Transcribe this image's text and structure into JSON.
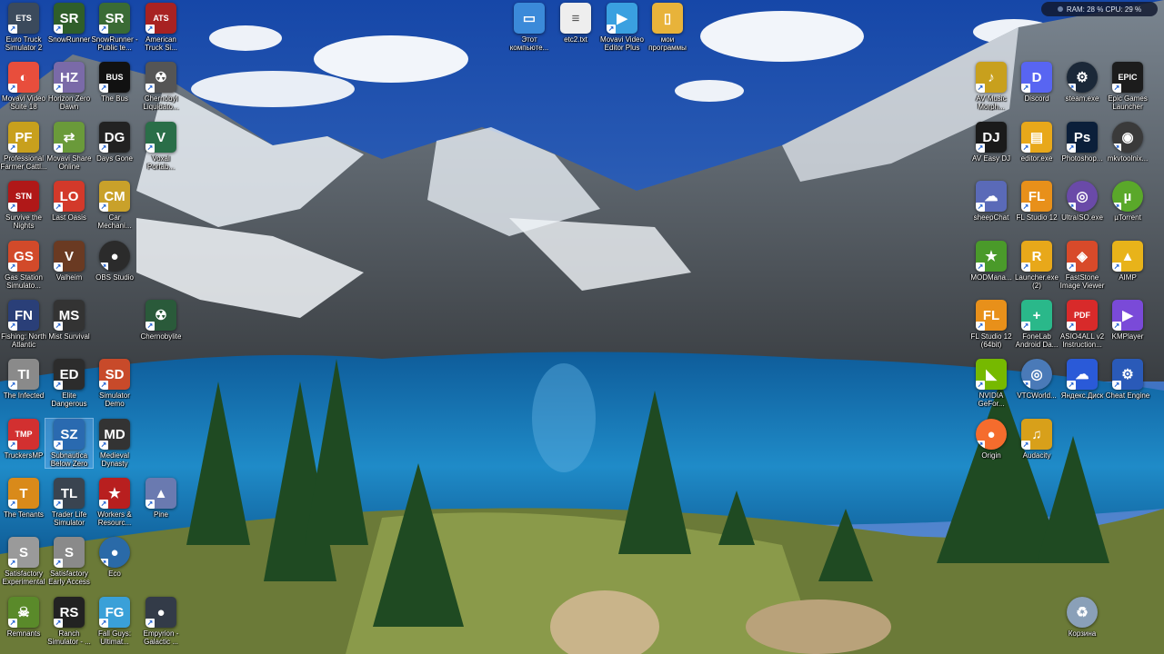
{
  "system_monitor": {
    "text": "RAM: 28 %  CPU: 29 %"
  },
  "desktop": {
    "icons": [
      {
        "label": "Euro Truck Simulator 2",
        "glyph": "ETS",
        "color": "#3b4a5c",
        "icon": "truck-icon"
      },
      {
        "label": "SnowRunner",
        "glyph": "SR",
        "color": "#2f5e2a",
        "icon": "truck-icon"
      },
      {
        "label": "SnowRunner - Public te...",
        "glyph": "SR",
        "color": "#3a6b35",
        "icon": "truck-icon"
      },
      {
        "label": "American Truck Si...",
        "glyph": "ATS",
        "color": "#a82222",
        "icon": "truck-icon"
      },
      {
        "label": "Movavi Video Suite 18",
        "glyph": "◐",
        "color": "#e84e3c",
        "icon": "movavi-icon"
      },
      {
        "label": "Horizon Zero Dawn",
        "glyph": "HZ",
        "color": "#7a6aa8",
        "icon": "game-icon"
      },
      {
        "label": "The Bus",
        "glyph": "BUS",
        "color": "#111111",
        "icon": "bus-icon"
      },
      {
        "label": "Chernobyl Liquidato...",
        "glyph": "☢",
        "color": "#555555",
        "icon": "gasmask-icon"
      },
      {
        "label": "Professional Farmer Cattl...",
        "glyph": "PF",
        "color": "#c8a01d",
        "icon": "tractor-icon"
      },
      {
        "label": "Movavi Share Online",
        "glyph": "⇄",
        "color": "#6a9a3a",
        "icon": "movavi-icon"
      },
      {
        "label": "Days Gone",
        "glyph": "DG",
        "color": "#222222",
        "icon": "game-icon"
      },
      {
        "label": "Voxal Portab...",
        "glyph": "V",
        "color": "#2a6e48",
        "icon": "voxal-icon"
      },
      {
        "label": "Survive the Nights",
        "glyph": "STN",
        "color": "#b01818",
        "icon": "game-icon"
      },
      {
        "label": "Last Oasis",
        "glyph": "LO",
        "color": "#d3392a",
        "icon": "game-icon"
      },
      {
        "label": "Car Mechani...",
        "glyph": "CM",
        "color": "#c9a12a",
        "icon": "car-icon"
      },
      {
        "label": "Gas Station Simulato...",
        "glyph": "GS",
        "color": "#d24a2a",
        "icon": "gas-icon"
      },
      {
        "label": "Valheim",
        "glyph": "V",
        "color": "#6a3a22",
        "icon": "game-icon"
      },
      {
        "label": "OBS Studio",
        "glyph": "●",
        "color": "#2b2b2b",
        "icon": "obs-icon"
      },
      {
        "label": "Fishing: North Atlantic",
        "glyph": "FN",
        "color": "#2a3f78",
        "icon": "fish-icon"
      },
      {
        "label": "Mist Survival",
        "glyph": "MS",
        "color": "#333333",
        "icon": "game-icon"
      },
      {
        "label": "Chernobylite",
        "glyph": "☢",
        "color": "#2a5a3a",
        "icon": "game-icon"
      },
      {
        "label": "The Infected",
        "glyph": "TI",
        "color": "#8a8a8a",
        "icon": "skull-icon"
      },
      {
        "label": "Elite Dangerous",
        "glyph": "ED",
        "color": "#2c2c2c",
        "icon": "game-icon"
      },
      {
        "label": "Simulator Demo",
        "glyph": "SD",
        "color": "#c84a2a",
        "icon": "game-icon"
      },
      {
        "label": "TruckersMP",
        "glyph": "TMP",
        "color": "#d23030",
        "icon": "truck-icon"
      },
      {
        "label": "Subnautica Below Zero",
        "glyph": "SZ",
        "color": "#2a6ab0",
        "icon": "game-icon"
      },
      {
        "label": "Medieval Dynasty",
        "glyph": "MD",
        "color": "#333333",
        "icon": "game-icon"
      },
      {
        "label": "The Tenants",
        "glyph": "T",
        "color": "#d98a1a",
        "icon": "game-icon"
      },
      {
        "label": "Trader Life Simulator",
        "glyph": "TL",
        "color": "#3a4450",
        "icon": "game-icon"
      },
      {
        "label": "Workers & Resourc...",
        "glyph": "★",
        "color": "#b81f1f",
        "icon": "star-icon"
      },
      {
        "label": "Pine",
        "glyph": "▲",
        "color": "#6a7ab0",
        "icon": "game-icon"
      },
      {
        "label": "Satisfactory Experimental",
        "glyph": "S",
        "color": "#9a9a9a",
        "icon": "game-icon"
      },
      {
        "label": "Satisfactory Early Access",
        "glyph": "S",
        "color": "#8a8a8a",
        "icon": "game-icon"
      },
      {
        "label": "Eco",
        "glyph": "●",
        "color": "#2a6aa8",
        "icon": "globe-icon"
      },
      {
        "label": "Remnants",
        "glyph": "☠",
        "color": "#5a8a2a",
        "icon": "game-icon"
      },
      {
        "label": "Ranch Simulator - ...",
        "glyph": "RS",
        "color": "#222222",
        "icon": "game-icon"
      },
      {
        "label": "Fall Guys: Ultimat...",
        "glyph": "FG",
        "color": "#3aa0d8",
        "icon": "game-icon"
      },
      {
        "label": "Empyrion - Galactic ...",
        "glyph": "●",
        "color": "#333b48",
        "icon": "game-icon"
      },
      {
        "label": "Этот компьюте...",
        "glyph": "▭",
        "color": "#3b8ad9",
        "icon": "computer-icon"
      },
      {
        "label": "etc2.txt",
        "glyph": "≡",
        "color": "#eeeeee",
        "icon": "text-file-icon"
      },
      {
        "label": "Movavi Video Editor Plus",
        "glyph": "▶",
        "color": "#3aa0e0",
        "icon": "movavi-icon"
      },
      {
        "label": "мои программы",
        "glyph": "▯",
        "color": "#e8b33a",
        "icon": "folder-icon"
      },
      {
        "label": "AV Music Morph...",
        "glyph": "♪",
        "color": "#c8a01d",
        "icon": "music-icon"
      },
      {
        "label": "Discord",
        "glyph": "D",
        "color": "#5865f2",
        "icon": "discord-icon"
      },
      {
        "label": "steam.exe",
        "glyph": "⚙",
        "color": "#1b2838",
        "icon": "steam-icon"
      },
      {
        "label": "Epic Games Launcher",
        "glyph": "EPIC",
        "color": "#1c1c1c",
        "icon": "epic-icon"
      },
      {
        "label": "AV Easy DJ",
        "glyph": "DJ",
        "color": "#1a1a1a",
        "icon": "dj-icon"
      },
      {
        "label": "editor.exe",
        "glyph": "▤",
        "color": "#e8a81a",
        "icon": "editor-icon"
      },
      {
        "label": "Photoshop...",
        "glyph": "Ps",
        "color": "#0b1f3a",
        "icon": "photoshop-icon"
      },
      {
        "label": "mkvtoolnix...",
        "glyph": "◉",
        "color": "#3a3a3a",
        "icon": "mkv-icon"
      },
      {
        "label": "sheepChat",
        "glyph": "☁",
        "color": "#5a6ab8",
        "icon": "chat-icon"
      },
      {
        "label": "FL Studio 12",
        "glyph": "FL",
        "color": "#e8901a",
        "icon": "flstudio-icon"
      },
      {
        "label": "UltraISO.exe",
        "glyph": "◎",
        "color": "#6a4aa8",
        "icon": "disc-icon"
      },
      {
        "label": "µTorrent",
        "glyph": "µ",
        "color": "#5aa82a",
        "icon": "utorrent-icon"
      },
      {
        "label": "MODMana...",
        "glyph": "★",
        "color": "#4a9a2a",
        "icon": "mod-icon"
      },
      {
        "label": "Launcher.exe (2)",
        "glyph": "R",
        "color": "#e8a81a",
        "icon": "launcher-icon"
      },
      {
        "label": "FastStone Image Viewer",
        "glyph": "◈",
        "color": "#d84a2a",
        "icon": "eye-icon"
      },
      {
        "label": "AIMP",
        "glyph": "▲",
        "color": "#e8b31a",
        "icon": "aimp-icon"
      },
      {
        "label": "FL Studio 12 (64bit)",
        "glyph": "FL",
        "color": "#e8901a",
        "icon": "flstudio-icon"
      },
      {
        "label": "FoneLab Android Da...",
        "glyph": "+",
        "color": "#2ab88a",
        "icon": "fonelab-icon"
      },
      {
        "label": "ASIO4ALL v2 Instruction...",
        "glyph": "PDF",
        "color": "#d82a2a",
        "icon": "pdf-icon"
      },
      {
        "label": "KMPlayer",
        "glyph": "▶",
        "color": "#7a4ad8",
        "icon": "kmplayer-icon"
      },
      {
        "label": "NVIDIA GeFor...",
        "glyph": "◣",
        "color": "#76b900",
        "icon": "nvidia-icon"
      },
      {
        "label": "VTCWorld...",
        "glyph": "◎",
        "color": "#4a7ab8",
        "icon": "globe-icon"
      },
      {
        "label": "Яндекс.Диск",
        "glyph": "☁",
        "color": "#2a5ad8",
        "icon": "cloud-icon"
      },
      {
        "label": "Cheat Engine",
        "glyph": "⚙",
        "color": "#2a5ab8",
        "icon": "cheat-engine-icon"
      },
      {
        "label": "Origin",
        "glyph": "●",
        "color": "#f56c2d",
        "icon": "origin-icon"
      },
      {
        "label": "Audacity",
        "glyph": "♫",
        "color": "#d8a01a",
        "icon": "audacity-icon"
      },
      {
        "label": "Корзина",
        "glyph": "♻",
        "color": "#8aa0b8",
        "icon": "recycle-bin-icon"
      }
    ]
  }
}
